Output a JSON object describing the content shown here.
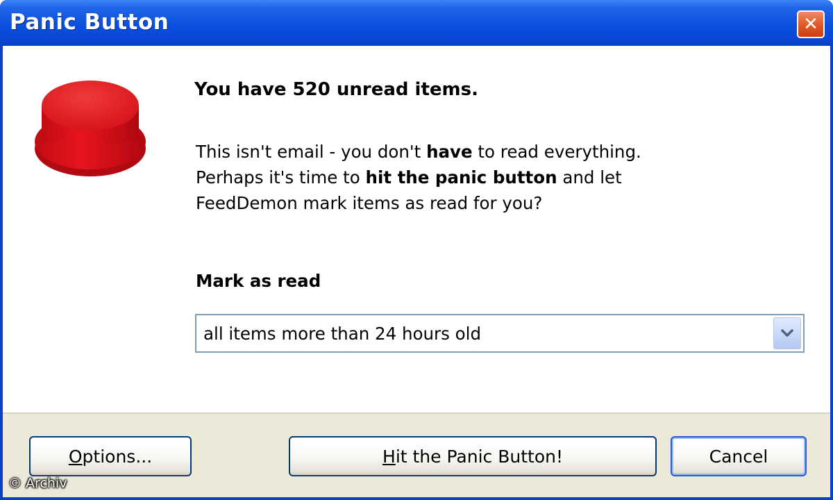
{
  "window": {
    "title": "Panic Button",
    "close_icon": "close-icon"
  },
  "message": {
    "headline": "You have 520 unread items.",
    "line1_a": "This isn't email - you don't ",
    "line1_b": "have",
    "line1_c": " to read everything.",
    "line2_a": "Perhaps it's time to ",
    "line2_b": "hit the panic button",
    "line2_c": " and let",
    "line3": "FeedDemon mark items as read for you?"
  },
  "mark_as_read": {
    "label": "Mark as read",
    "selected": "all items more than 24 hours old",
    "arrow_icon": "chevron-down-icon"
  },
  "buttons": {
    "options_access": "O",
    "options_rest": "ptions...",
    "hit_access": "H",
    "hit_rest": "it the Panic Button!",
    "cancel": "Cancel"
  },
  "watermark": "© Archiv",
  "colors": {
    "titlebar": "#0a48d6",
    "close_button": "#e25b2c",
    "panic_red": "#e0141e",
    "footer": "#ece9d8",
    "default_button_border": "#2a5bd7"
  }
}
